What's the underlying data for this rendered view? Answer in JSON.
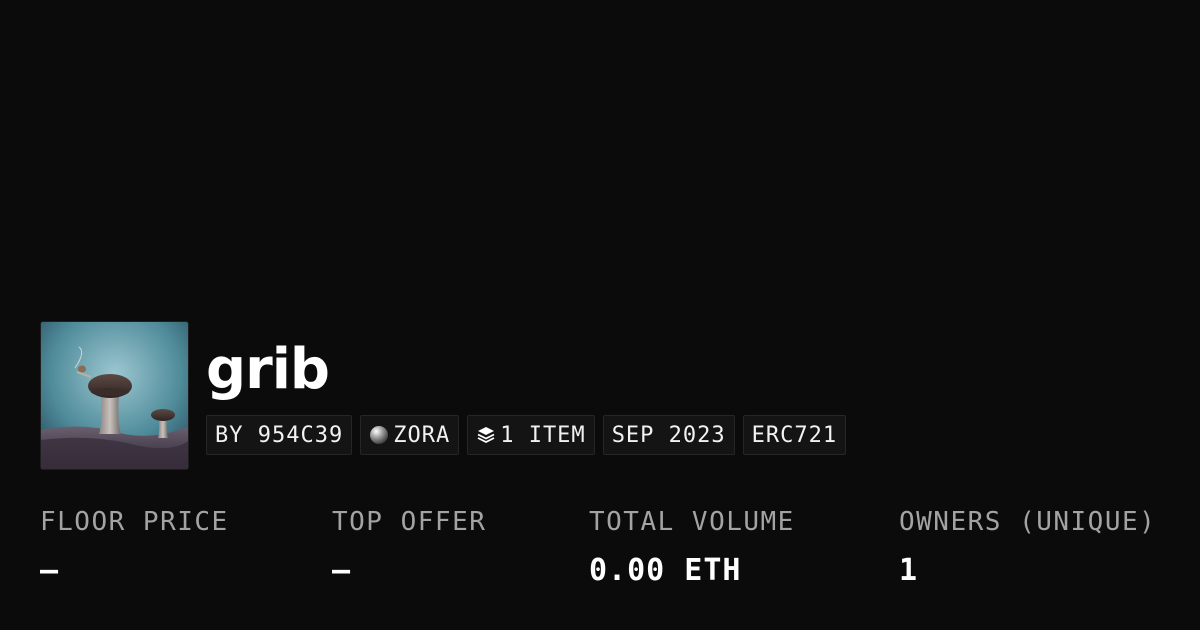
{
  "collection": {
    "name": "grib",
    "image_icon": "mushroom-artwork-image"
  },
  "tags": [
    {
      "label": "BY 954C39"
    },
    {
      "label": "ZORA",
      "icon": "zora-orb-icon"
    },
    {
      "label": "1 ITEM",
      "icon": "layers-icon"
    },
    {
      "label": "SEP 2023"
    },
    {
      "label": "ERC721"
    }
  ],
  "stats": [
    {
      "label": "FLOOR PRICE",
      "value": "–"
    },
    {
      "label": "TOP OFFER",
      "value": "–"
    },
    {
      "label": "TOTAL VOLUME",
      "value": "0.00 ETH"
    },
    {
      "label": "OWNERS (UNIQUE)",
      "value": "1"
    }
  ],
  "colors": {
    "background": "#0b0b0b",
    "tag_background": "#141414",
    "tag_border": "#262626",
    "label_gray": "#a3a3a3",
    "text": "#ffffff"
  }
}
